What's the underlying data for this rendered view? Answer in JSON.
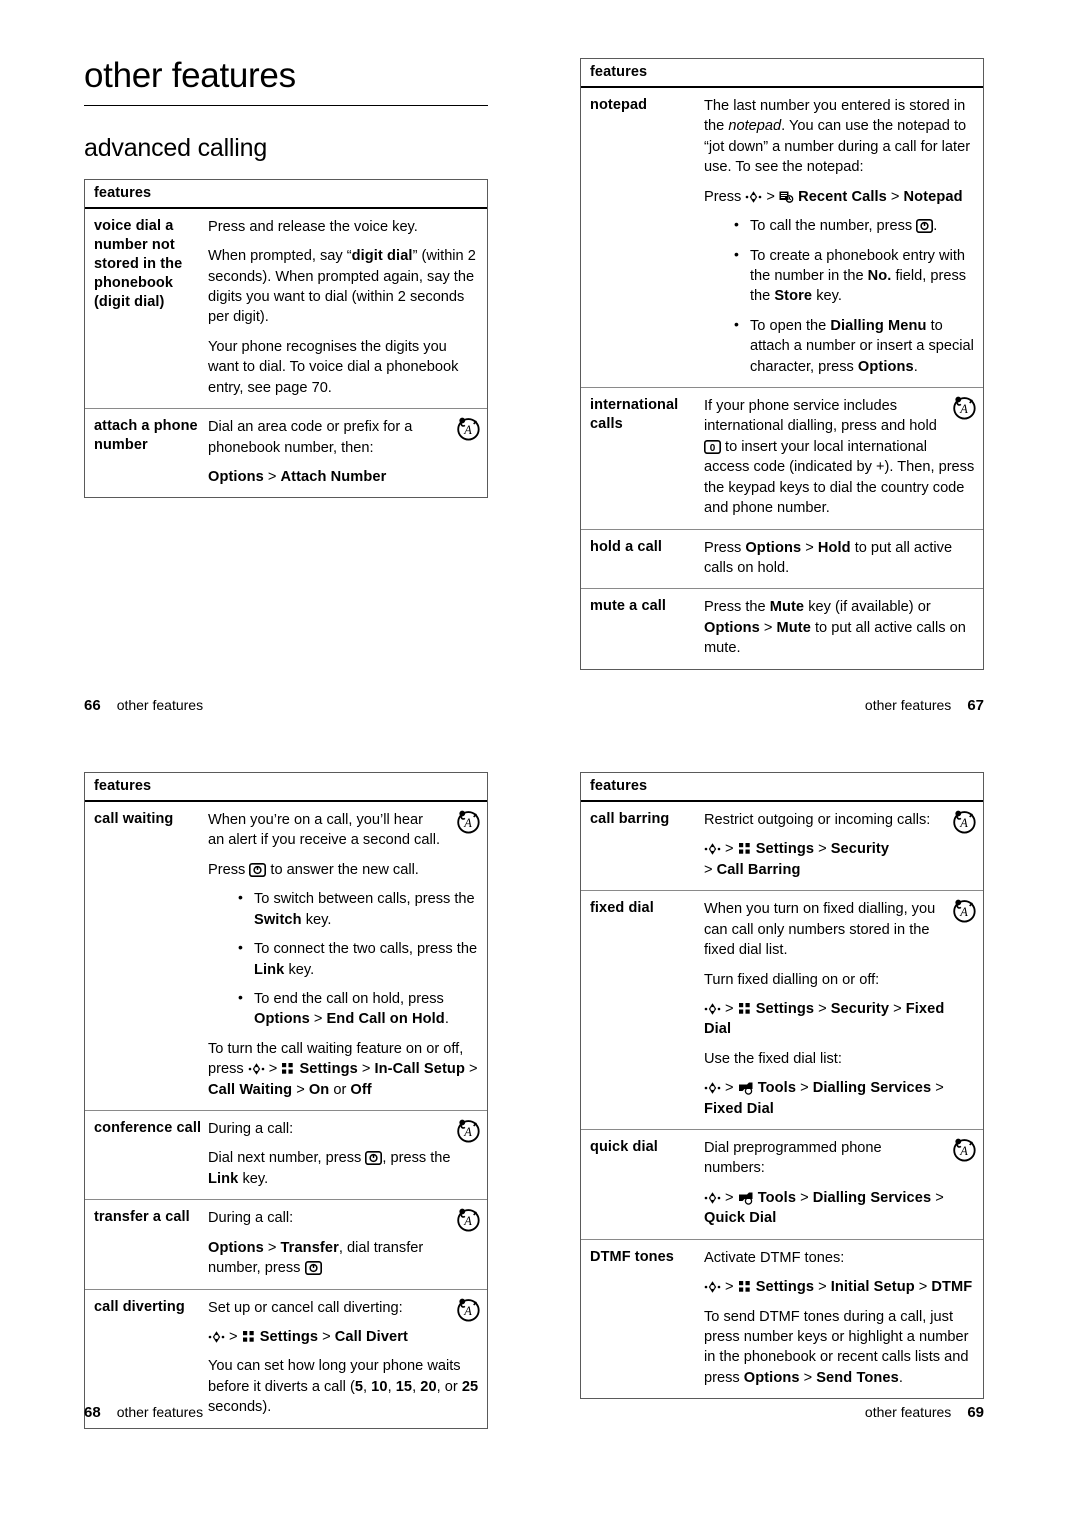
{
  "document": {
    "chapter_title": "other features",
    "section_title": "advanced calling",
    "table_header": "features"
  },
  "pages": [
    {
      "number": "66",
      "running_head": "other features",
      "align": "left"
    },
    {
      "number": "67",
      "running_head": "other features",
      "align": "right"
    },
    {
      "number": "68",
      "running_head": "other features",
      "align": "left"
    },
    {
      "number": "69",
      "running_head": "other features",
      "align": "right"
    }
  ],
  "icons": {
    "network_service": "network-service-icon",
    "nav_key": "navigation-key-icon",
    "send_key": "send-call-key-icon",
    "zero_key": "zero-key-icon",
    "settings_menu": "settings-menu-icon",
    "tools_menu": "tools-menu-icon",
    "recent_calls_menu": "recent-calls-menu-icon"
  },
  "tables": {
    "page66": {
      "header": "features",
      "rows": [
        {
          "label": "voice dial a number not stored in the phonebook (digit dial)",
          "has_service_icon": false,
          "paragraphs": [
            "Press and release the voice key.",
            "When prompted, say “digit dial” (within 2 seconds). When prompted again, say the digits you want to dial (within 2 seconds per digit).",
            "Your phone recognises the digits you want to dial. To voice dial a phonebook entry, see page 70."
          ]
        },
        {
          "label": "attach a phone number",
          "has_service_icon": true,
          "paragraphs": [
            "Dial an area code or prefix for a phonebook number, then:",
            "Options > Attach Number"
          ]
        }
      ]
    },
    "page67": {
      "header": "features",
      "rows": [
        {
          "label": "notepad",
          "has_service_icon": false,
          "paragraphs": [
            "The last number you entered is stored in the notepad. You can use the notepad to “jot down” a number during a call for later use. To see the notepad:",
            "Press ◆ > Recent Calls > Notepad"
          ],
          "bullets": [
            "To call the number, press [send].",
            "To create a phonebook entry with the number in the No. field, press the Store key.",
            "To open the Dialling Menu to attach a number or insert a special character, press Options."
          ]
        },
        {
          "label": "international calls",
          "has_service_icon": true,
          "paragraphs": [
            "If your phone service includes international dialling, press and hold [0] to insert your local international access code (indicated by +). Then, press the keypad keys to dial the country code and phone number."
          ]
        },
        {
          "label": "hold a call",
          "has_service_icon": false,
          "paragraphs": [
            "Press Options > Hold to put all active calls on hold."
          ]
        },
        {
          "label": "mute a call",
          "has_service_icon": false,
          "paragraphs": [
            "Press the Mute key (if available) or Options > Mute to put all active calls on mute."
          ]
        }
      ]
    },
    "page68": {
      "header": "features",
      "rows": [
        {
          "label": "call waiting",
          "has_service_icon": true,
          "paragraphs": [
            "When you’re on a call, you’ll hear an alert if you receive a second call.",
            "Press [send] to answer the new call.",
            "To turn the call waiting feature on or off, press ◆ > Settings > In-Call Setup > Call Waiting > On or Off"
          ],
          "bullets": [
            "To switch between calls, press the Switch key.",
            "To connect the two calls, press the Link key.",
            "To end the call on hold, press Options > End Call on Hold."
          ]
        },
        {
          "label": "conference call",
          "has_service_icon": true,
          "paragraphs": [
            "During a call:",
            "Dial next number, press [send], press the Link key."
          ]
        },
        {
          "label": "transfer a call",
          "has_service_icon": true,
          "paragraphs": [
            "During a call:",
            "Options > Transfer, dial transfer number, press [send]"
          ]
        },
        {
          "label": "call diverting",
          "has_service_icon": true,
          "paragraphs": [
            "Set up or cancel call diverting:",
            "◆ > Settings > Call Divert",
            "You can set how long your phone waits before it diverts a call (5, 10, 15, 20, or 25 seconds)."
          ]
        }
      ]
    },
    "page69": {
      "header": "features",
      "rows": [
        {
          "label": "call barring",
          "has_service_icon": true,
          "paragraphs": [
            "Restrict outgoing or incoming calls:",
            "◆ > Settings > Security > Call Barring"
          ]
        },
        {
          "label": "fixed dial",
          "has_service_icon": true,
          "paragraphs": [
            "When you turn on fixed dialling, you can call only numbers stored in the fixed dial list.",
            "Turn fixed dialling on or off:",
            "◆ > Settings > Security > Fixed Dial",
            "Use the fixed dial list:",
            "◆ > Tools > Dialling Services > Fixed Dial"
          ]
        },
        {
          "label": "quick dial",
          "has_service_icon": true,
          "paragraphs": [
            "Dial preprogrammed phone numbers:",
            "◆ > Tools > Dialling Services > Quick Dial"
          ]
        },
        {
          "label": "DTMF tones",
          "has_service_icon": false,
          "paragraphs": [
            "Activate DTMF tones:",
            "◆ > Settings > Initial Setup > DTMF",
            "To send DTMF tones during a call, just press number keys or highlight a number in the phonebook or recent calls lists and press Options > Send Tones."
          ]
        }
      ]
    }
  }
}
